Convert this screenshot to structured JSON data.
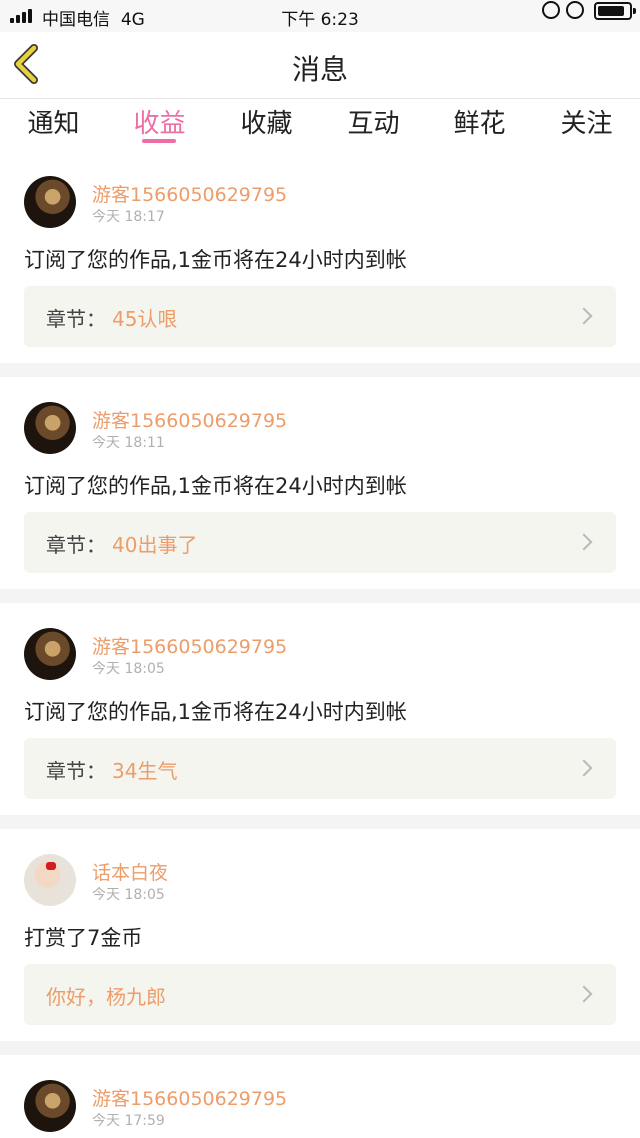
{
  "status_bar": {
    "carrier": "中国电信",
    "network": "4G",
    "time": "下午 6:23"
  },
  "header": {
    "title": "消息",
    "back_icon": "chevron-left-icon",
    "accent": "#e8d13a"
  },
  "tabs": [
    {
      "label": "通知",
      "active": false
    },
    {
      "label": "收益",
      "active": true
    },
    {
      "label": "收藏",
      "active": false
    },
    {
      "label": "互动",
      "active": false
    },
    {
      "label": "鲜花",
      "active": false
    },
    {
      "label": "关注",
      "active": false
    }
  ],
  "colors": {
    "accent_pink": "#ec6fa6",
    "username_orange": "#ec9d6a"
  },
  "messages": [
    {
      "username": "游客1566050629795",
      "time": "今天 18:17",
      "text": "订阅了您的作品,1金币将在24小时内到帐",
      "ref_prefix": "章节：",
      "ref_value": "45认哏"
    },
    {
      "username": "游客1566050629795",
      "time": "今天 18:11",
      "text": "订阅了您的作品,1金币将在24小时内到帐",
      "ref_prefix": "章节：",
      "ref_value": "40出事了"
    },
    {
      "username": "游客1566050629795",
      "time": "今天 18:05",
      "text": "订阅了您的作品,1金币将在24小时内到帐",
      "ref_prefix": "章节：",
      "ref_value": "34生气"
    },
    {
      "username": "话本白夜",
      "time": "今天 18:05",
      "text": "打赏了7金币",
      "ref_prefix": "",
      "ref_value": "你好，杨九郎"
    },
    {
      "username": "游客1566050629795",
      "time": "今天 17:59"
    }
  ]
}
